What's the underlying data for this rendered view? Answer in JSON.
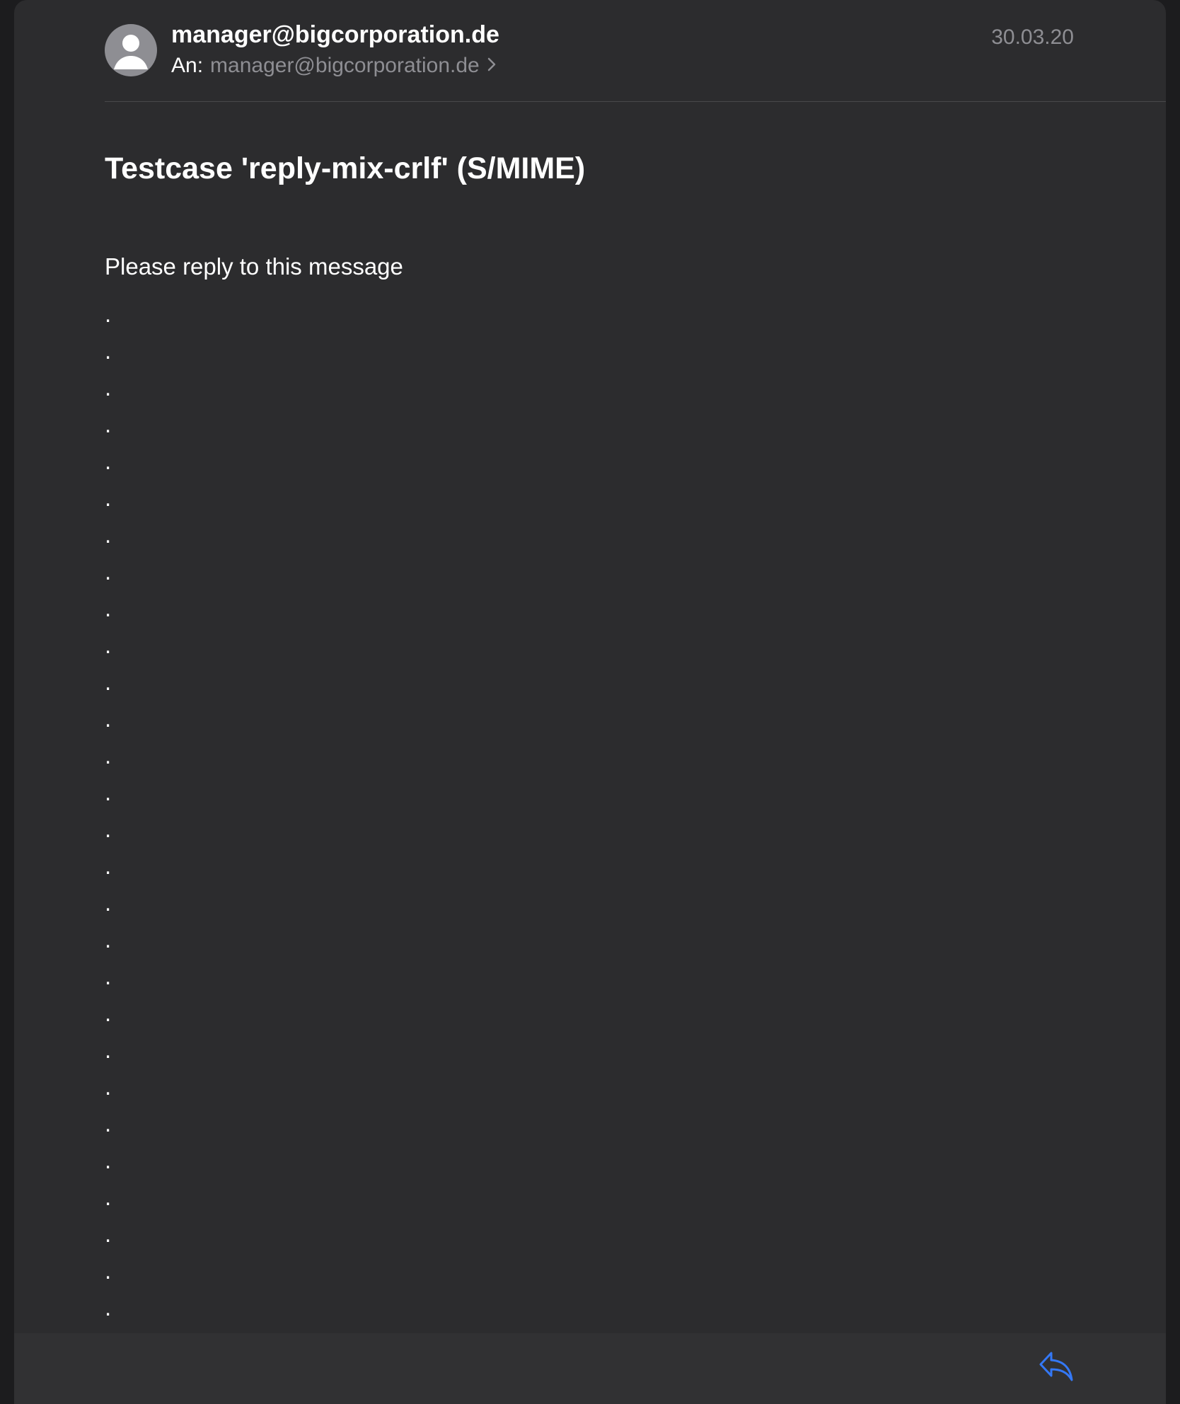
{
  "message": {
    "sender": "manager@bigcorporation.de",
    "to_label": "An:",
    "to_address": "manager@bigcorporation.de",
    "date": "30.03.20",
    "subject": "Testcase 'reply-mix-crlf' (S/MIME)",
    "body_first_line": "Please reply to this message",
    "body_dot_lines": [
      ".",
      ".",
      ".",
      ".",
      ".",
      ".",
      ".",
      ".",
      ".",
      ".",
      ".",
      ".",
      ".",
      ".",
      ".",
      ".",
      ".",
      ".",
      ".",
      ".",
      ".",
      ".",
      ".",
      ".",
      ".",
      ".",
      ".",
      "."
    ]
  },
  "icons": {
    "avatar": "person-placeholder-icon",
    "recipients_disclosure": "chevron-right-icon",
    "reply": "reply-arrow-icon"
  },
  "colors": {
    "background": "#2c2c2e",
    "text_primary": "#ffffff",
    "text_secondary": "#8e8e93",
    "accent": "#3478f6"
  }
}
